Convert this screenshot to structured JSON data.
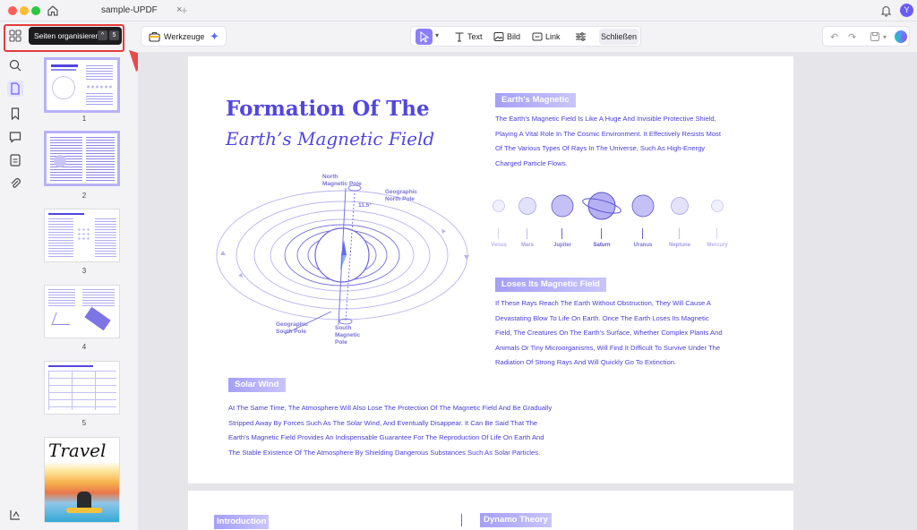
{
  "window": {
    "tab_title": "sample-UPDF",
    "tab_close": "×",
    "new_tab": "+",
    "avatar_letter": "Y"
  },
  "toolbar": {
    "tooltip_label": "Seiten organisieren",
    "tooltip_keys": [
      "^",
      "5"
    ],
    "tools_label": "Werkzeuge",
    "text_label": "Text",
    "image_label": "Bild",
    "link_label": "Link",
    "close_label": "Schließen"
  },
  "thumbnails": {
    "pages": [
      "1",
      "2",
      "3",
      "4",
      "5"
    ],
    "page6_title": "Travel"
  },
  "document": {
    "title": "Formation Of The",
    "subtitle": "Earth’s Magnetic Field",
    "earths_magnetic": {
      "heading": "Earth's Magnetic",
      "lines": [
        "The Earth's Magnetic Field Is Like A Huge And Invisible Protective Shield,",
        "Playing A Vital Role In The Cosmic Environment. It Effectively Resists Most",
        "Of The Various Types Of Rays In The Universe, Such As High-Energy",
        "Charged Particle Flows."
      ]
    },
    "loses": {
      "heading": "Loses Its Magnetic Field",
      "lines": [
        "If These Rays Reach The Earth Without Obstruction, They Will Cause A",
        "Devastating Blow To Life On Earth. Once The Earth Loses Its Magnetic",
        "Field, The Creatures On The Earth's Surface, Whether Complex Plants And",
        "Animals Or Tiny Microorganisms, Will Find It Difficult To Survive Under The",
        "Radiation Of Strong Rays And Will Quickly Go To Extinction."
      ]
    },
    "solar_wind": {
      "heading": "Solar Wind",
      "lines": [
        "At The Same Time, The Atmosphere Will Also Lose The Protection Of The Magnetic Field And Be Gradually",
        "Stripped Away By Forces Such As The Solar Wind, And Eventually Disappear. It Can Be Said That The",
        "Earth's Magnetic Field Provides An Indispensable Guarantee For The Reproduction Of Life On Earth And",
        "The Stable Existence Of The Atmosphere By Shielding Dangerous Substances Such As Solar Particles."
      ]
    },
    "diagram_labels": {
      "north_magnetic": "North\nMagnetic Pole",
      "geo_north": "Geographic\nNorth Pole",
      "angle": "11.5°",
      "geo_south": "Geographic\nSouth Pole",
      "south_magnetic": "South\nMagnetic\nPole"
    },
    "planets": [
      "Venus",
      "Mars",
      "Jupiter",
      "Saturn",
      "Uranus",
      "Neptune",
      "Mercury"
    ],
    "page2": {
      "introduction": "Introduction",
      "dynamo": "Dynamo Theory"
    }
  }
}
